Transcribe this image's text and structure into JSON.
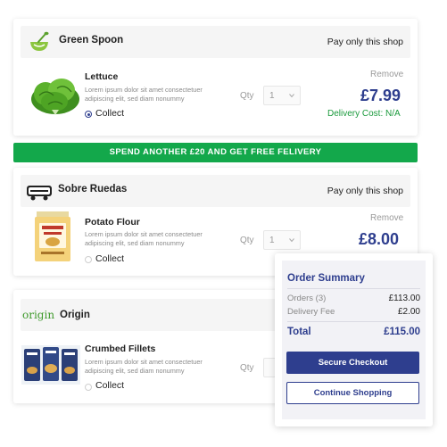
{
  "colors": {
    "brand": "#2e3e8e",
    "banner": "#13a84b",
    "delivery": "#1a9a3c"
  },
  "banner": {
    "text": "SPEND ANOTHER £20 AND GET FREE FELIVERY"
  },
  "shops": [
    {
      "name": "Green Spoon",
      "logo_icon": "green-spoon-logo",
      "pay_link": "Pay only this shop",
      "product": {
        "name": "Lettuce",
        "image_icon": "lettuce-image",
        "description": "Lorem ipsum dolor sit amet consectetuer adipiscing elit, sed diam nonummy",
        "collect_label": "Collect",
        "collect_selected": true,
        "qty_label": "Qty",
        "qty_value": "1",
        "remove_label": "Remove",
        "price": "£7.99",
        "delivery_cost": "Delivery Cost: N/A"
      }
    },
    {
      "name": "Sobre Ruedas",
      "logo_icon": "sobre-ruedas-logo",
      "pay_link": "Pay only this shop",
      "product": {
        "name": "Potato Flour",
        "image_icon": "potato-flour-bag-image",
        "description": "Lorem ipsum dolor sit amet consectetuer adipiscing elit, sed diam nonummy",
        "collect_label": "Collect",
        "collect_selected": false,
        "qty_label": "Qty",
        "qty_value": "1",
        "remove_label": "Remove",
        "price": "£8.00"
      }
    },
    {
      "name": "Origin",
      "logo_text": "origin",
      "logo_icon": "origin-logo",
      "product": {
        "name": "Crumbed Fillets",
        "image_icon": "crumbed-fillets-packages-image",
        "description": "Lorem ipsum dolor sit amet consectetuer adipiscing elit, sed diam nonummy",
        "collect_label": "Collect",
        "collect_selected": false,
        "qty_label": "Qty"
      }
    }
  ],
  "summary": {
    "title": "Order Summary",
    "orders_label": "Orders (3)",
    "orders_value": "£113.00",
    "delivery_label": "Delivery Fee",
    "delivery_value": "£2.00",
    "total_label": "Total",
    "total_value": "£115.00",
    "checkout_label": "Secure Checkout",
    "continue_label": "Continue Shopping"
  }
}
